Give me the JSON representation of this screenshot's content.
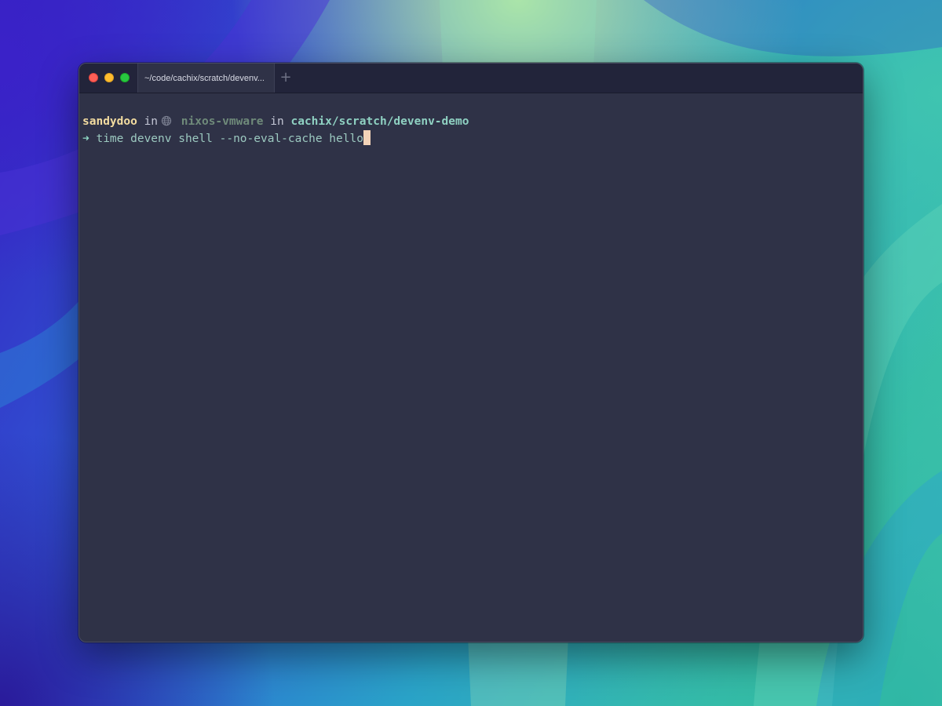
{
  "window": {
    "tab_title": "~/code/cachix/scratch/devenv...",
    "new_tab_symbol": "+"
  },
  "prompt": {
    "user": "sandydoo",
    "in_word_1": "in",
    "host_icon": "globe-icon",
    "host": "nixos-vmware",
    "in_word_2": "in",
    "directory": "cachix/scratch/devenv-demo",
    "arrow": "➜",
    "command": "time devenv shell --no-eval-cache hello"
  },
  "colors": {
    "terminal_bg": "#2f3247",
    "titlebar_bg": "#22243a",
    "user": "#f3dca0",
    "directory": "#8fd1c2",
    "command": "#9cc9c0",
    "cursor": "#f2d3b8"
  }
}
